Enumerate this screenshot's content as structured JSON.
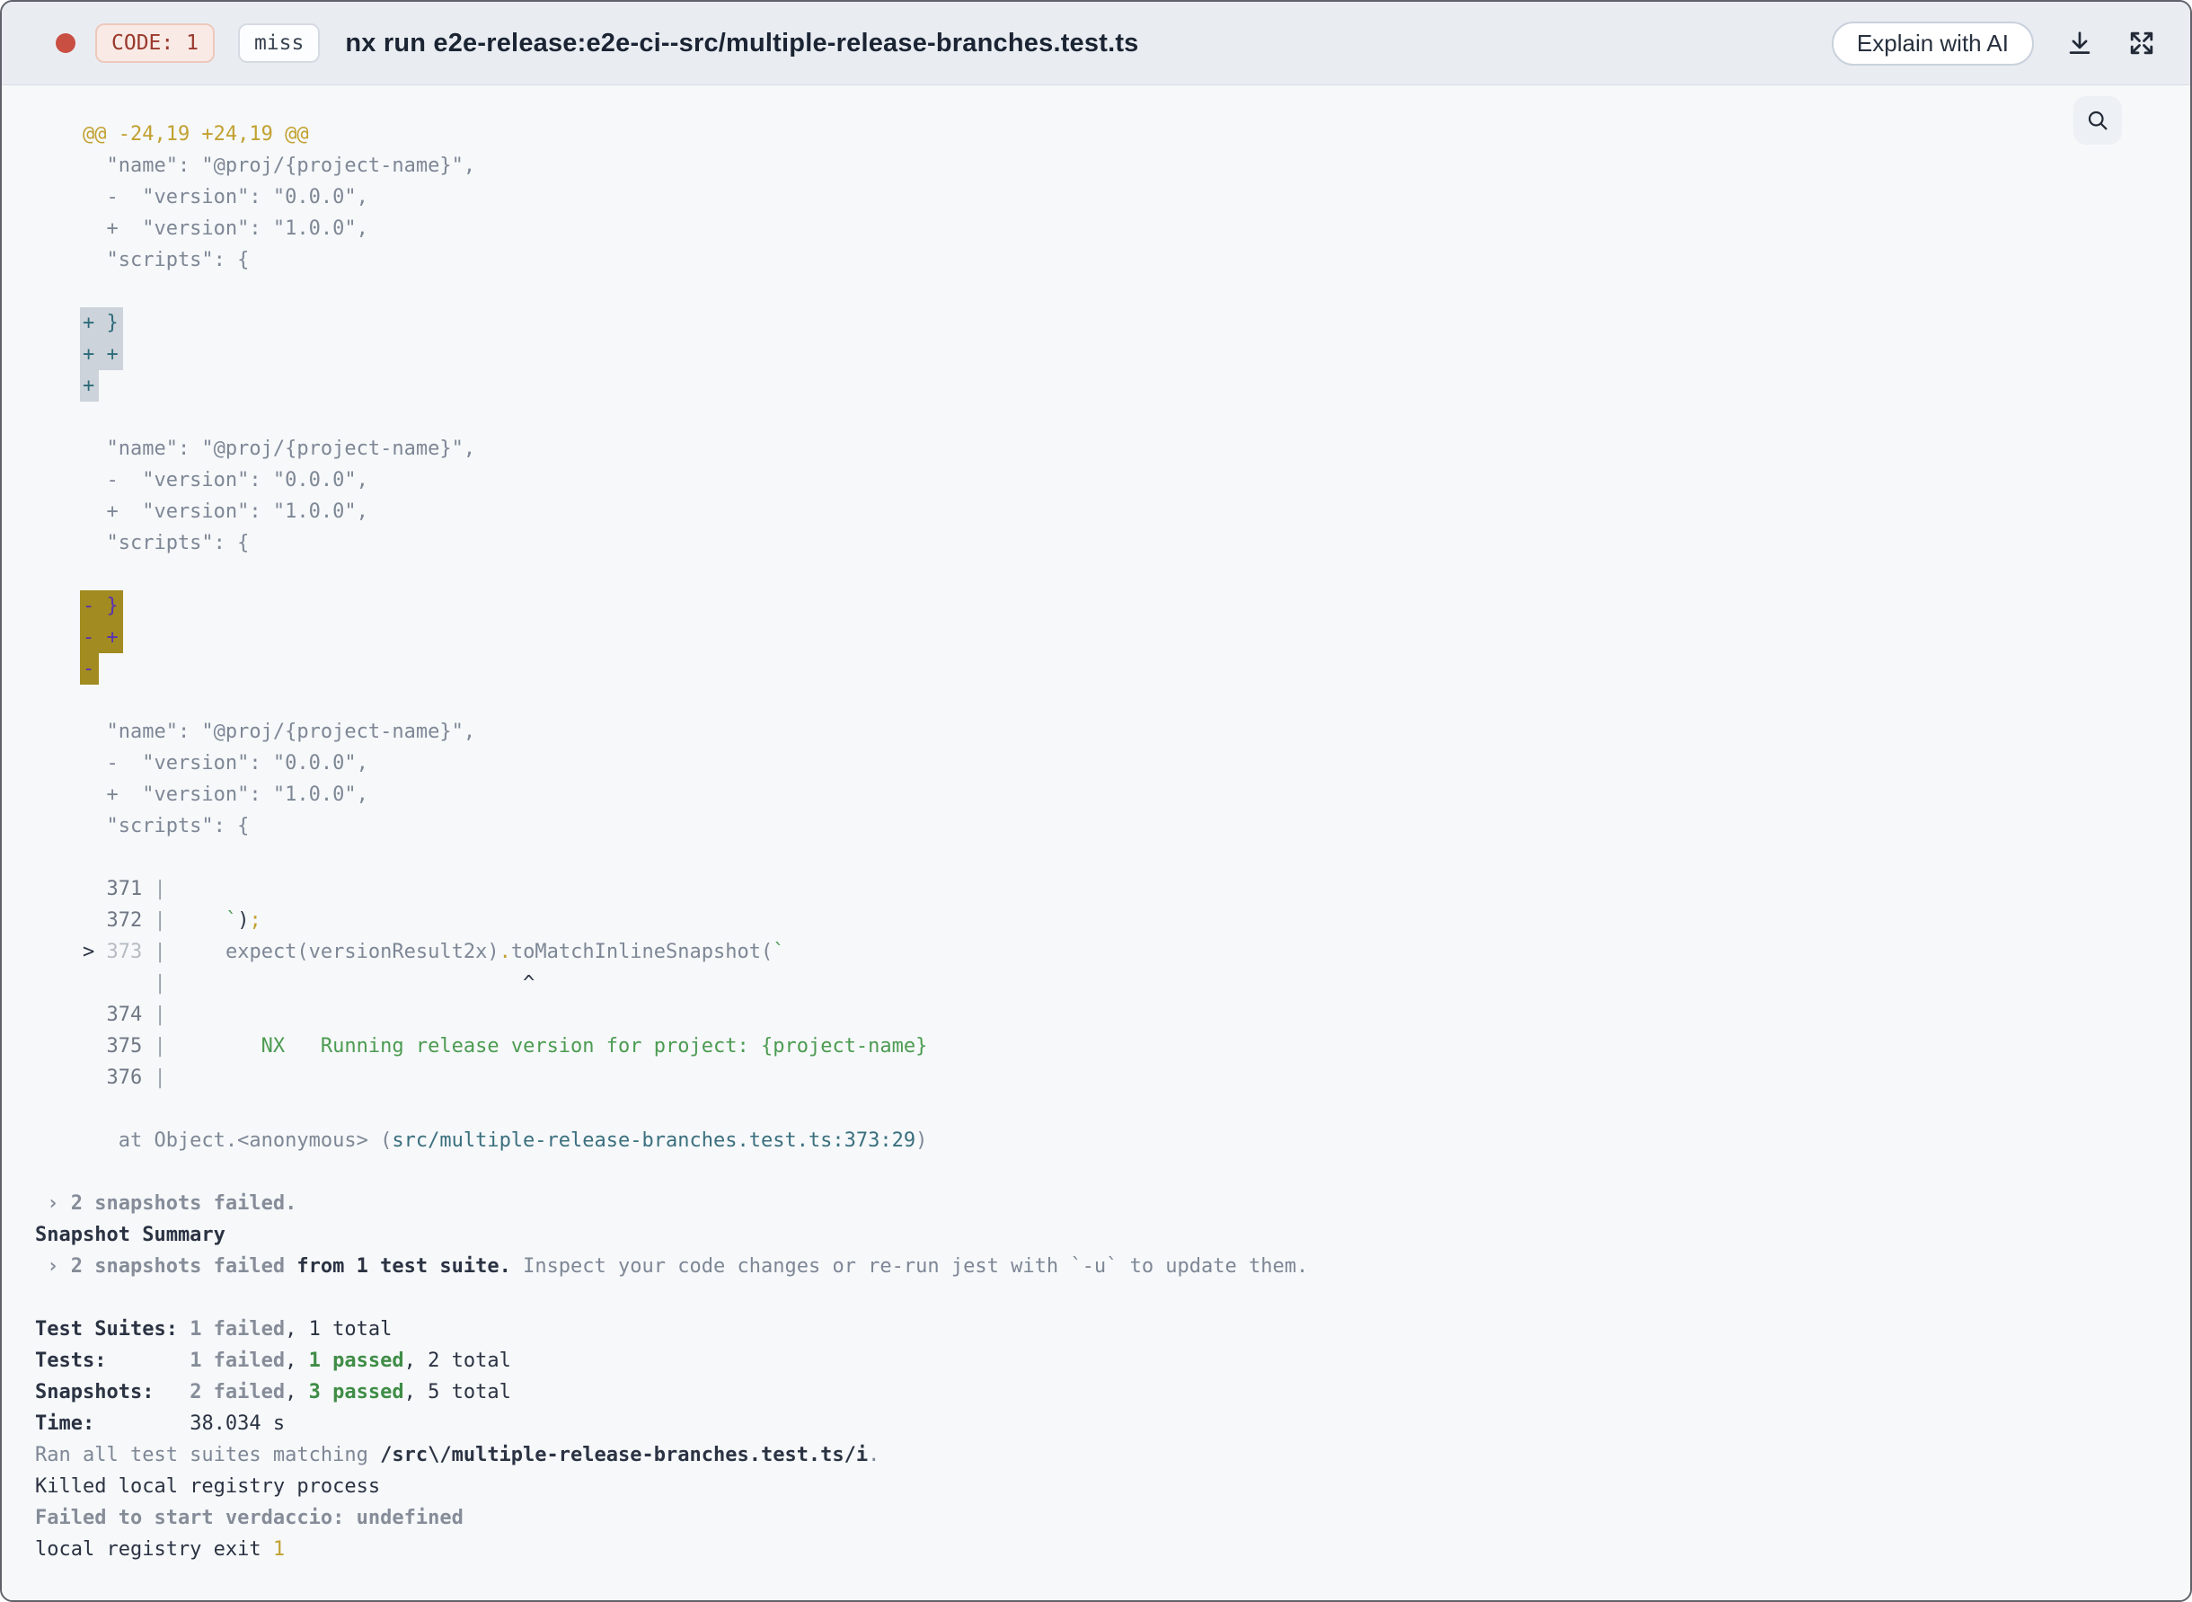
{
  "header": {
    "exit_code_label": "CODE: 1",
    "cache_status": "miss",
    "title": "nx run e2e-release:e2e-ci--src/multiple-release-branches.test.ts",
    "explain_button": "Explain with AI",
    "icons": [
      "status-dot",
      "download-icon",
      "fullscreen-icon",
      "search-icon"
    ]
  },
  "colors": {
    "header_bg": "#e9edf2",
    "terminal_bg": "#f6f8fa",
    "status_dot": "#c94f43",
    "exit_code_text": "#9a392d",
    "diff_header": "#c2a130",
    "success_green": "#4c9b51",
    "file_link_teal": "#3a6f7e",
    "highlight_added_bg": "#ccd3da",
    "highlight_added_text": "#2d6b7a",
    "highlight_removed_bg": "#a28b20",
    "highlight_removed_text": "#5a31b5"
  },
  "terminal": {
    "lines": [
      [
        [
          "gray",
          "    "
        ],
        [
          "gold",
          "@@ -24,19 +24,19 @@"
        ]
      ],
      [
        [
          "gray",
          "      \"name\": \"@proj/{project-name}\","
        ]
      ],
      [
        [
          "gray",
          "      -  \"version\": \"0.0.0\","
        ]
      ],
      [
        [
          "gray",
          "      +  \"version\": \"1.0.0\","
        ]
      ],
      [
        [
          "gray",
          "      \"scripts\": {"
        ]
      ],
      [],
      [
        [
          "gray",
          "    "
        ],
        [
          "hlAdd",
          "+ }"
        ]
      ],
      [
        [
          "gray",
          "    "
        ],
        [
          "hlAdd",
          "+ +"
        ]
      ],
      [
        [
          "gray",
          "    "
        ],
        [
          "hlAdd",
          "+"
        ]
      ],
      [],
      [
        [
          "gray",
          "      \"name\": \"@proj/{project-name}\","
        ]
      ],
      [
        [
          "gray",
          "      -  \"version\": \"0.0.0\","
        ]
      ],
      [
        [
          "gray",
          "      +  \"version\": \"1.0.0\","
        ]
      ],
      [
        [
          "gray",
          "      \"scripts\": {"
        ]
      ],
      [],
      [
        [
          "gray",
          "    "
        ],
        [
          "hlDel",
          "- }"
        ]
      ],
      [
        [
          "gray",
          "    "
        ],
        [
          "hlDel",
          "- +"
        ]
      ],
      [
        [
          "gray",
          "    "
        ],
        [
          "hlDel",
          "-"
        ]
      ],
      [],
      [
        [
          "gray",
          "      \"name\": \"@proj/{project-name}\","
        ]
      ],
      [
        [
          "gray",
          "      -  \"version\": \"0.0.0\","
        ]
      ],
      [
        [
          "gray",
          "      +  \"version\": \"1.0.0\","
        ]
      ],
      [
        [
          "gray",
          "      \"scripts\": {"
        ]
      ],
      [],
      [
        [
          "num",
          "      371"
        ],
        [
          "pipe",
          " |"
        ]
      ],
      [
        [
          "num",
          "      372"
        ],
        [
          "pipe",
          " |"
        ],
        [
          "gray",
          "     "
        ],
        [
          "green",
          "`"
        ],
        [
          "dark",
          ")"
        ],
        [
          "gold",
          ";"
        ]
      ],
      [
        [
          "gray",
          "    "
        ],
        [
          "dark",
          "> "
        ],
        [
          "numFaint",
          "373"
        ],
        [
          "pipe",
          " |"
        ],
        [
          "gray",
          "     expect(versionResult2x)"
        ],
        [
          "gold",
          "."
        ],
        [
          "gray",
          "toMatchInlineSnapshot("
        ],
        [
          "green",
          "`"
        ]
      ],
      [
        [
          "pipe",
          "          |"
        ],
        [
          "dark",
          "                              ^"
        ]
      ],
      [
        [
          "num",
          "      374"
        ],
        [
          "pipe",
          " |"
        ]
      ],
      [
        [
          "num",
          "      375"
        ],
        [
          "pipe",
          " |"
        ],
        [
          "green",
          "        NX   Running release version for project: {project-name}"
        ]
      ],
      [
        [
          "num",
          "      376"
        ],
        [
          "pipe",
          " |"
        ]
      ],
      [],
      [
        [
          "gray",
          "       at Object.<anonymous> ("
        ],
        [
          "teal",
          "src/multiple-release-branches.test.ts:373:29"
        ],
        [
          "gray",
          ")"
        ]
      ],
      [],
      [
        [
          "boldGray",
          " › 2 snapshots failed."
        ]
      ],
      [
        [
          "boldDark",
          "Snapshot Summary"
        ]
      ],
      [
        [
          "boldGray",
          " › 2 snapshots failed"
        ],
        [
          "boldDark",
          " from 1 test suite."
        ],
        [
          "gray",
          " Inspect your code changes or re-run jest with `-u` to update them."
        ]
      ],
      [],
      [
        [
          "boldDark",
          "Test Suites: "
        ],
        [
          "boldGray",
          "1 failed"
        ],
        [
          "dark",
          ", 1 total"
        ]
      ],
      [
        [
          "boldDark",
          "Tests:       "
        ],
        [
          "boldGray",
          "1 failed"
        ],
        [
          "dark",
          ", "
        ],
        [
          "boldGreen",
          "1 passed"
        ],
        [
          "dark",
          ", 2 total"
        ]
      ],
      [
        [
          "boldDark",
          "Snapshots:   "
        ],
        [
          "boldGray",
          "2 failed"
        ],
        [
          "dark",
          ", "
        ],
        [
          "boldGreen",
          "3 passed"
        ],
        [
          "dark",
          ", 5 total"
        ]
      ],
      [
        [
          "boldDark",
          "Time:"
        ],
        [
          "dark",
          "        38.034 s"
        ]
      ],
      [
        [
          "gray",
          "Ran all test suites matching "
        ],
        [
          "boldDark",
          "/src\\/multiple-release-branches.test.ts/i"
        ],
        [
          "gray",
          "."
        ]
      ],
      [
        [
          "dark",
          "Killed local registry process"
        ]
      ],
      [
        [
          "boldGray",
          "Failed to start verdaccio: undefined"
        ]
      ],
      [
        [
          "dark",
          "local registry exit "
        ],
        [
          "gold",
          "1"
        ]
      ]
    ]
  }
}
